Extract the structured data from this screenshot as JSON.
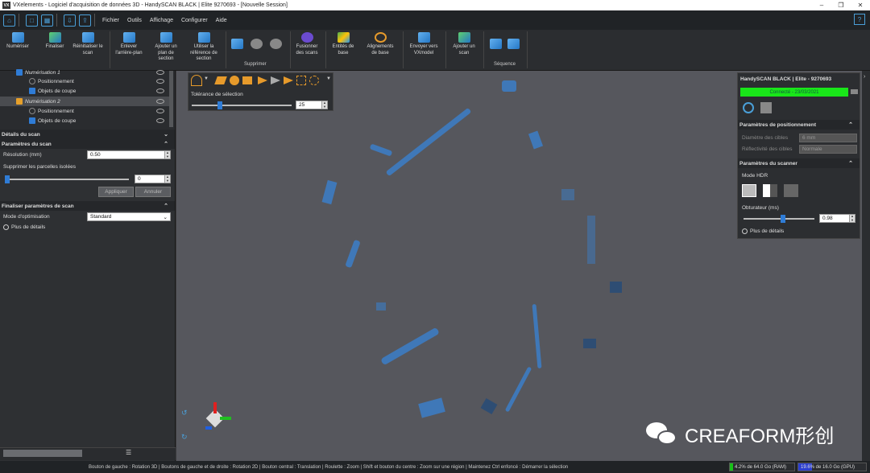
{
  "window": {
    "title": "VXelements - Logiciel d'acquisition de données 3D - HandySCAN BLACK | Elite 9270693 - [Nouvelle Session]",
    "logo": "VX"
  },
  "menu": [
    "Fichier",
    "Outils",
    "Affichage",
    "Configurer",
    "Aide"
  ],
  "ribbon": {
    "numeriser": "Numériser",
    "finaliser": "Finaliser",
    "reinit": [
      "Réinitialiser le",
      "scan"
    ],
    "enlever": [
      "Enlever",
      "l'arrière-plan"
    ],
    "ajouter_plan": [
      "Ajouter un",
      "plan de",
      "section"
    ],
    "utiliser_ref": [
      "Utiliser la",
      "référence de",
      "section"
    ],
    "supprimer": "Supprimer",
    "fusionner": [
      "Fusionner",
      "des scans"
    ],
    "entites": [
      "Entités de",
      "base"
    ],
    "alignements": [
      "Alignements",
      "de base"
    ],
    "envoyer": [
      "Envoyer vers",
      "VXmodel"
    ],
    "ajouter_scan": [
      "Ajouter un",
      "scan"
    ],
    "sequence": "Séquence"
  },
  "tree": [
    {
      "label": "Numérisation 1"
    },
    {
      "label": "Positionnement"
    },
    {
      "label": "Objets de coupe"
    },
    {
      "label": "Numérisation 2"
    },
    {
      "label": "Positionnement"
    },
    {
      "label": "Objets de coupe"
    }
  ],
  "details": {
    "title": "Détails du scan"
  },
  "params": {
    "title": "Paramètres du scan",
    "resolution_label": "Résolution (mm)",
    "resolution": "0.50",
    "supprimer_label": "Supprimer les parcelles isolées",
    "supprimer_value": "0",
    "appliquer": "Appliquer",
    "annuler": "Annuler"
  },
  "finaliser": {
    "title": "Finaliser paramètres de scan",
    "mode_label": "Mode d'optimisation",
    "mode": "Standard",
    "plus": "Plus de détails"
  },
  "selection": {
    "label": "Tolérance de sélection",
    "value": "25"
  },
  "scanner": {
    "name": "HandySCAN BLACK | Elite - 9270693",
    "status": "Connecté - 23/03/2021",
    "pos_title": "Paramètres de positionnement",
    "diam_label": "Diamètre des cibles",
    "diam": "6 mm",
    "refl_label": "Réflectivité des cibles",
    "refl": "Normale",
    "scan_title": "Paramètres du scanner",
    "hdr": "Mode HDR",
    "obt_label": "Obturateur (ms)",
    "obt": "0.98",
    "plus": "Plus de détails"
  },
  "status": {
    "hint": "Bouton de gauche : Rotation 3D  |  Boutons de gauche et de droite : Rotation 2D  |  Bouton central : Translation  |  Roulette : Zoom  |  Shift et bouton du centre : Zoom sur une région  |  Maintenez Ctrl enfoncé : Démarrer la sélection",
    "ram": "4.2% de 64.0 Go (RAM)",
    "gpu": "19.6% de 16.0 Go (GPU)"
  },
  "watermark": "CREAFORM形创",
  "colors": {
    "connected": "#19e619",
    "accent": "#2f7cd6",
    "part": "#3f78b8"
  }
}
